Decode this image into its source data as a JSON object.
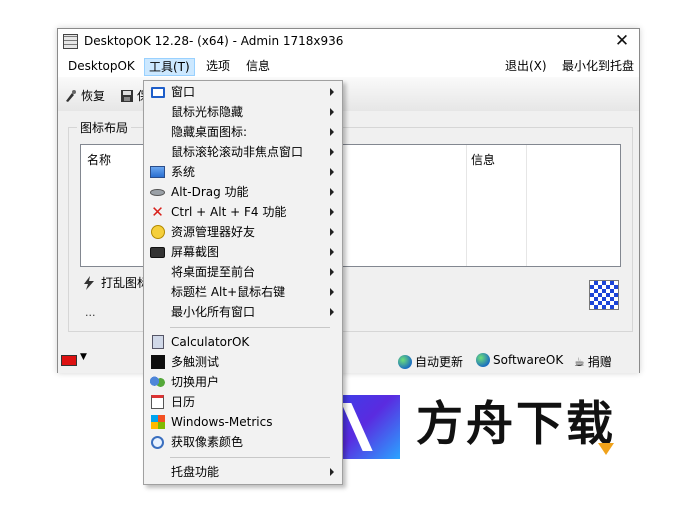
{
  "window": {
    "title": "DesktopOK 12.28- (x64) - Admin 1718x936",
    "close_glyph": "✕"
  },
  "menubar": {
    "items": [
      "DesktopOK",
      "工具(T)",
      "选项",
      "信息"
    ],
    "right": [
      "退出(X)",
      "最小化到托盘"
    ]
  },
  "toolbar": {
    "restore": "恢复",
    "save_partial": "保"
  },
  "layout_group": {
    "title": "图标布局",
    "columns": [
      "名称",
      "信息"
    ],
    "scramble_partial": "打乱图标",
    "ellipsis": "..."
  },
  "statusbar": {
    "auto_update": "自动更新",
    "softwareok": "SoftwareOK",
    "donate": "捐赠"
  },
  "tools_menu": {
    "items": [
      {
        "label": "窗口",
        "icon": "window-icon",
        "submenu": true
      },
      {
        "label": "鼠标光标隐藏",
        "icon": "",
        "submenu": true
      },
      {
        "label": "隐藏桌面图标:",
        "icon": "",
        "submenu": true
      },
      {
        "label": "鼠标滚轮滚动非焦点窗口",
        "icon": "",
        "submenu": true
      },
      {
        "label": "系统",
        "icon": "system-icon",
        "submenu": true
      },
      {
        "label": "Alt-Drag 功能",
        "icon": "mouse-icon",
        "submenu": true
      },
      {
        "label": "Ctrl + Alt + F4 功能",
        "icon": "red-x-icon",
        "submenu": true
      },
      {
        "label": "资源管理器好友",
        "icon": "smiley-icon",
        "submenu": true
      },
      {
        "label": "屏幕截图",
        "icon": "camera-icon",
        "submenu": true
      },
      {
        "label": "将桌面提至前台",
        "icon": "",
        "submenu": true
      },
      {
        "label": "标题栏 Alt+鼠标右键",
        "icon": "",
        "submenu": true
      },
      {
        "label": "最小化所有窗口",
        "icon": "",
        "submenu": true
      }
    ],
    "apps": [
      {
        "label": "CalculatorOK",
        "icon": "calculator-icon"
      },
      {
        "label": "多触测试",
        "icon": "touch-test-icon"
      },
      {
        "label": "切换用户",
        "icon": "users-icon"
      },
      {
        "label": "日历",
        "icon": "calendar-icon"
      },
      {
        "label": "Windows-Metrics",
        "icon": "windows-icon"
      },
      {
        "label": "获取像素颜色",
        "icon": "magnifier-icon"
      }
    ],
    "tray": {
      "label": "托盘功能",
      "submenu": true
    }
  },
  "watermark": {
    "text": "方舟下载"
  }
}
